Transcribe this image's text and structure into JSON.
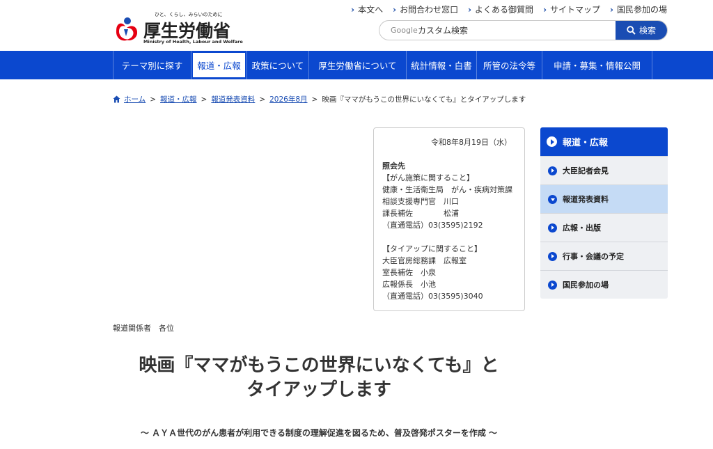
{
  "header": {
    "logo_tagline": "ひと、くらし、みらいのために",
    "logo_name": "厚生労働省",
    "logo_en": "Ministry of Health, Labour and Welfare",
    "util_links": [
      "本文へ",
      "お問合わせ窓口",
      "よくある御質問",
      "サイトマップ",
      "国民参加の場"
    ],
    "search_brand": "Google",
    "search_placeholder": "カスタム検索",
    "search_button": "検索"
  },
  "nav": {
    "items": [
      "テーマ別に探す",
      "報道・広報",
      "政策について",
      "厚生労働省について",
      "統計情報・白書",
      "所管の法令等",
      "申請・募集・情報公開"
    ],
    "active_index": 1
  },
  "breadcrumb": {
    "items": [
      "ホーム",
      "報道・広報",
      "報道発表資料",
      "2026年8月"
    ],
    "current": "映画『ママがもうこの世界にいなくても』とタイアップします"
  },
  "contact": {
    "date": "令和8年8月19日（水）",
    "heading": "照会先",
    "lines": [
      "【がん施策に関すること】",
      "健康・生活衛生局　がん・疾病対策課",
      "相談支援専門官　川口",
      "課長補佐　　　　松浦",
      "（直通電話）03(3595)2192",
      "",
      "【タイアップに関すること】",
      "大臣官房総務課　広報室",
      "室長補佐　小泉",
      "広報係長　小池",
      "（直通電話）03(3595)3040"
    ]
  },
  "side_nav": {
    "heading": "報道・広報",
    "items": [
      "大臣記者会見",
      "報道発表資料",
      "広報・出版",
      "行事・会議の予定",
      "国民参加の場"
    ],
    "current_index": 1
  },
  "article": {
    "addressee": "報道関係者　各位",
    "title_line1": "映画『ママがもうこの世界にいなくても』と",
    "title_line2": "タイアップします",
    "subtitle": "～ ＡＹＡ世代のがん患者が利用できる制度の理解促進を図るため、普及啓発ポスターを作成 ～"
  },
  "colors": {
    "brand_blue": "#0b48cf",
    "link_blue": "#1a4db3",
    "side_current": "#c5dbf5",
    "logo_red": "#e60012"
  }
}
